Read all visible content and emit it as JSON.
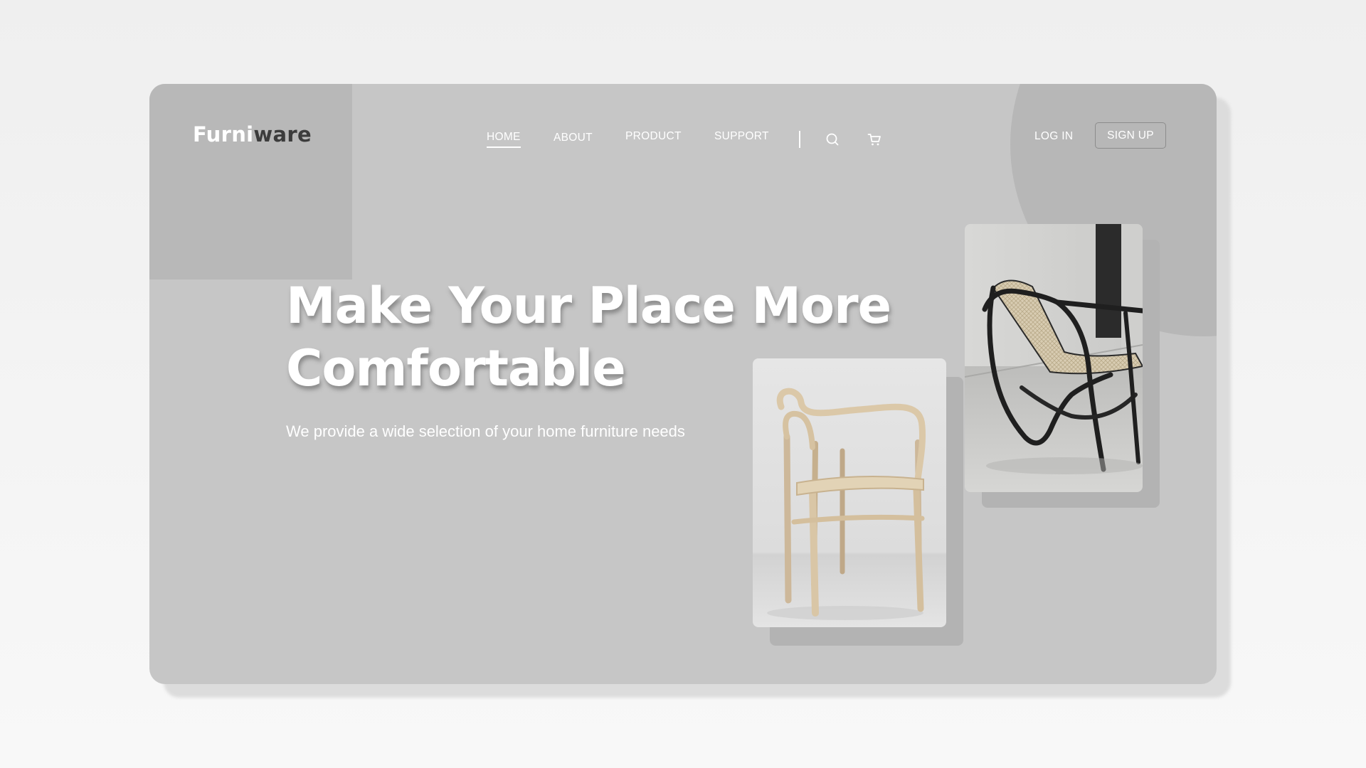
{
  "logo": {
    "part1": "Furni",
    "part2": "ware"
  },
  "nav": {
    "items": [
      {
        "label": "HOME",
        "active": true
      },
      {
        "label": "ABOUT"
      },
      {
        "label": "PRODUCT"
      },
      {
        "label": "SUPPORT"
      }
    ]
  },
  "icons": {
    "search": "search-icon",
    "cart": "cart-icon"
  },
  "auth": {
    "login": "LOG IN",
    "signup": "SIGN UP"
  },
  "hero": {
    "title_line1": "Make Your Place More",
    "title_line2": "Comfortable",
    "subtitle": "We provide a wide selection of your home furniture needs"
  },
  "images": {
    "left": "wooden-chair-photo",
    "right": "black-rattan-lounge-chair-photo"
  },
  "colors": {
    "page_bg": "#f2f2f2",
    "card_bg": "#c6c6c6",
    "accent_block": "#b8b8b8",
    "logo_dark": "#3c3c3c",
    "text": "#ffffff"
  }
}
